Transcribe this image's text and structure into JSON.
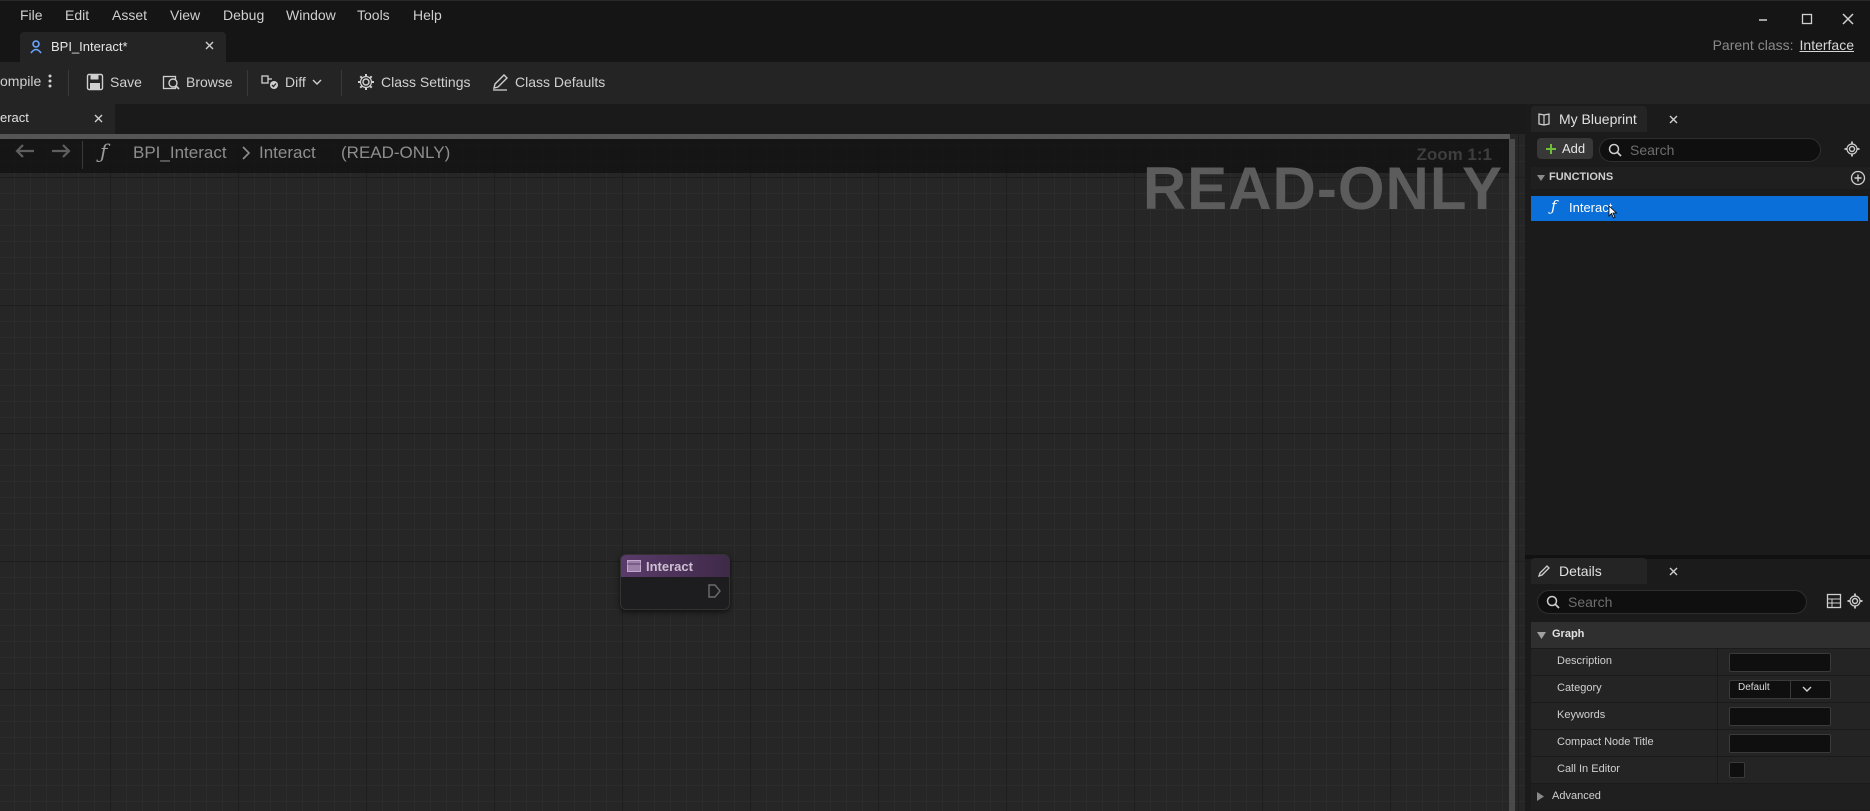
{
  "menu": [
    "File",
    "Edit",
    "Asset",
    "View",
    "Debug",
    "Window",
    "Tools",
    "Help"
  ],
  "document_tab": {
    "title": "BPI_Interact*"
  },
  "parent_class": {
    "label": "Parent class:",
    "value": "Interface"
  },
  "toolbar": {
    "compile": "ompile",
    "save": "Save",
    "browse": "Browse",
    "diff": "Diff",
    "class_settings": "Class Settings",
    "class_defaults": "Class Defaults"
  },
  "graph": {
    "tab_label": "eract",
    "breadcrumb_root": "BPI_Interact",
    "breadcrumb_leaf": "Interact",
    "readonly_tag": "(READ-ONLY)",
    "watermark": "READ-ONLY",
    "zoom": "Zoom 1:1",
    "node_title": "Interact"
  },
  "my_blueprint": {
    "tab_label": "My Blueprint",
    "add_label": "Add",
    "search_placeholder": "Search",
    "functions_header": "FUNCTIONS",
    "functions": [
      {
        "label": "Interact",
        "selected": true
      }
    ]
  },
  "details": {
    "tab_label": "Details",
    "search_placeholder": "Search",
    "section": "Graph",
    "rows": {
      "description": "Description",
      "category": "Category",
      "category_value": "Default",
      "keywords": "Keywords",
      "compact_node_title": "Compact Node Title",
      "call_in_editor": "Call In Editor"
    },
    "advanced": "Advanced"
  },
  "colors": {
    "selection": "#0a6fd8",
    "node_header": "#5a3a6a",
    "add_icon": "#6fbf3a"
  }
}
